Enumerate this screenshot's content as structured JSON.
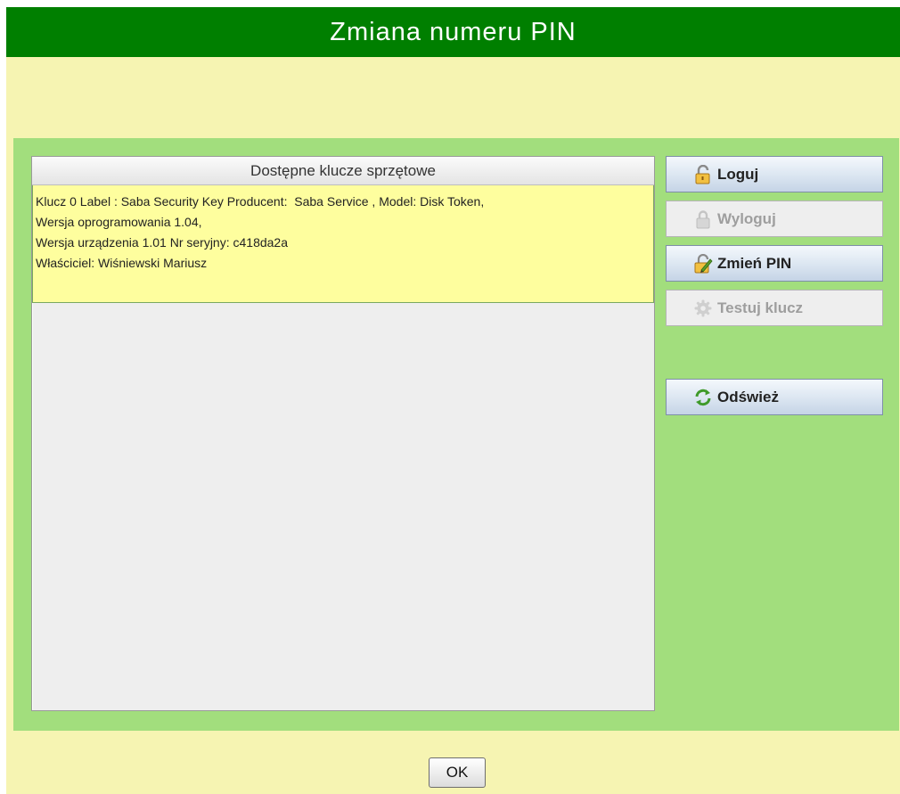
{
  "dialog": {
    "title": "Zmiana numeru PIN"
  },
  "keys_panel": {
    "header": "Dostępne klucze sprzętowe",
    "items": [
      {
        "lines": [
          "Klucz 0 Label : Saba Security Key Producent:  Saba Service , Model: Disk Token,",
          "Wersja oprogramowania 1.04,",
          "Wersja urządzenia 1.01 Nr seryjny: c418da2a",
          "Właściciel: Wiśniewski Mariusz"
        ],
        "selected": true
      }
    ]
  },
  "buttons": {
    "login": {
      "label": "Loguj",
      "icon": "padlock-open-icon",
      "enabled": true
    },
    "logout": {
      "label": "Wyloguj",
      "icon": "padlock-icon",
      "enabled": false
    },
    "change_pin": {
      "label": "Zmień PIN",
      "icon": "edit-icon",
      "enabled": true
    },
    "test_key": {
      "label": "Testuj klucz",
      "icon": "gear-icon",
      "enabled": false
    },
    "refresh": {
      "label": "Odśwież",
      "icon": "refresh-icon",
      "enabled": true
    },
    "ok": {
      "label": "OK"
    }
  },
  "colors": {
    "titlebar": "#007f00",
    "dialog_background": "#f6f4b2",
    "panel_background": "#a2de7d",
    "selected_row": "#fefe9e"
  }
}
